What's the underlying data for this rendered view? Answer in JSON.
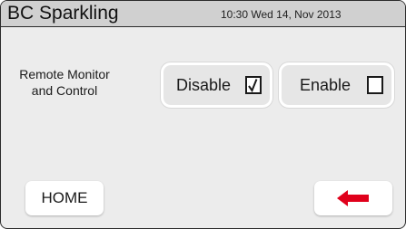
{
  "header": {
    "app_title": "BC Sparkling",
    "datetime": "10:30 Wed 14, Nov 2013"
  },
  "setting": {
    "label_line1": "Remote Monitor",
    "label_line2": "and Control",
    "options": [
      {
        "label": "Disable",
        "checked": true
      },
      {
        "label": "Enable",
        "checked": false
      }
    ]
  },
  "footer": {
    "home_label": "HOME",
    "back_icon": "back-arrow-icon",
    "back_icon_color": "#e0001b"
  }
}
